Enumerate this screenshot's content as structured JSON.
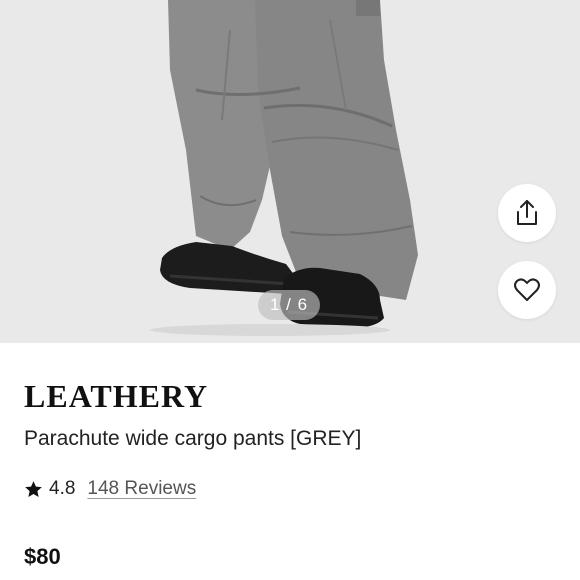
{
  "gallery": {
    "pager_text": "1 / 6",
    "share_icon": "share-icon",
    "favorite_icon": "heart-icon"
  },
  "product": {
    "brand": "LEATHERY",
    "name": "Parachute wide cargo pants [GREY]",
    "rating": "4.8",
    "reviews_link": "148 Reviews",
    "price": "$80"
  },
  "colors": {
    "hero_background": "#e9e9e9",
    "pants": "#8a8a8a",
    "shoes": "#1a1a1a",
    "text": "#111111"
  }
}
